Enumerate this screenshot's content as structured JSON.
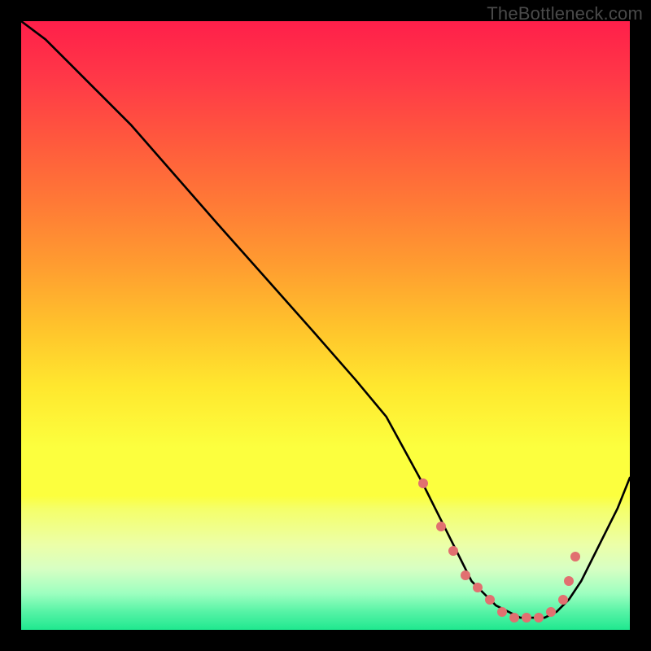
{
  "watermark": "TheBottleneck.com",
  "colors": {
    "black": "#000000",
    "curve": "#000000",
    "marker": "#e17070",
    "gradient_stops": [
      {
        "offset": 0.0,
        "color": "#ff1f4a"
      },
      {
        "offset": 0.1,
        "color": "#ff3a47"
      },
      {
        "offset": 0.2,
        "color": "#ff5a3d"
      },
      {
        "offset": 0.3,
        "color": "#ff7a36"
      },
      {
        "offset": 0.4,
        "color": "#ff9c30"
      },
      {
        "offset": 0.5,
        "color": "#ffc22c"
      },
      {
        "offset": 0.6,
        "color": "#ffe72e"
      },
      {
        "offset": 0.7,
        "color": "#fcff3e"
      },
      {
        "offset": 0.78,
        "color": "#fcff3e"
      },
      {
        "offset": 0.8,
        "color": "#f5ff68"
      },
      {
        "offset": 0.86,
        "color": "#ecffa8"
      },
      {
        "offset": 0.9,
        "color": "#d7ffc3"
      },
      {
        "offset": 0.94,
        "color": "#9dffc0"
      },
      {
        "offset": 0.97,
        "color": "#57f3a6"
      },
      {
        "offset": 1.0,
        "color": "#1fe88f"
      }
    ]
  },
  "chart_data": {
    "type": "line",
    "title": "",
    "xlabel": "",
    "ylabel": "",
    "xlim": [
      0,
      100
    ],
    "ylim": [
      0,
      100
    ],
    "series": [
      {
        "name": "bottleneck-curve",
        "x": [
          0,
          4,
          8,
          12,
          18,
          25,
          32,
          40,
          48,
          55,
          60,
          66,
          68,
          70,
          72,
          74,
          76,
          78,
          80,
          82,
          84,
          86,
          88,
          90,
          92,
          94,
          96,
          98,
          100
        ],
        "y": [
          100,
          97,
          93,
          89,
          83,
          75,
          67,
          58,
          49,
          41,
          35,
          24,
          20,
          16,
          12,
          8,
          6,
          4,
          3,
          2,
          2,
          2,
          3,
          5,
          8,
          12,
          16,
          20,
          25
        ]
      }
    ],
    "markers": {
      "name": "highlight-points",
      "x": [
        66,
        69,
        71,
        73,
        75,
        77,
        79,
        81,
        83,
        85,
        87,
        89,
        90,
        91
      ],
      "y": [
        24,
        17,
        13,
        9,
        7,
        5,
        3,
        2,
        2,
        2,
        3,
        5,
        8,
        12
      ]
    }
  }
}
